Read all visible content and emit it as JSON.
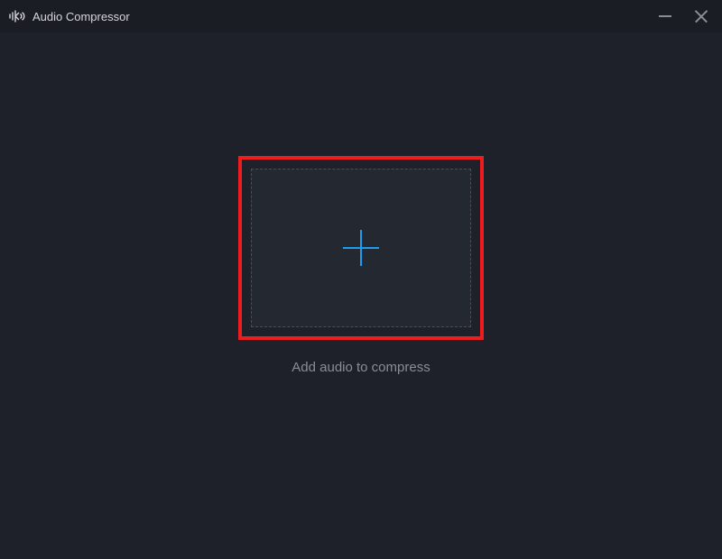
{
  "window": {
    "title": "Audio Compressor"
  },
  "main": {
    "instruction": "Add audio to compress"
  },
  "colors": {
    "accent": "#1e9df0",
    "highlight": "#ee1c1c",
    "bg": "#1e2129",
    "titlebar": "#1a1d24",
    "dropzone": "#242831"
  },
  "icons": {
    "app": "audio-compressor-icon",
    "minimize": "minimize-icon",
    "close": "close-icon",
    "add": "plus-icon"
  }
}
